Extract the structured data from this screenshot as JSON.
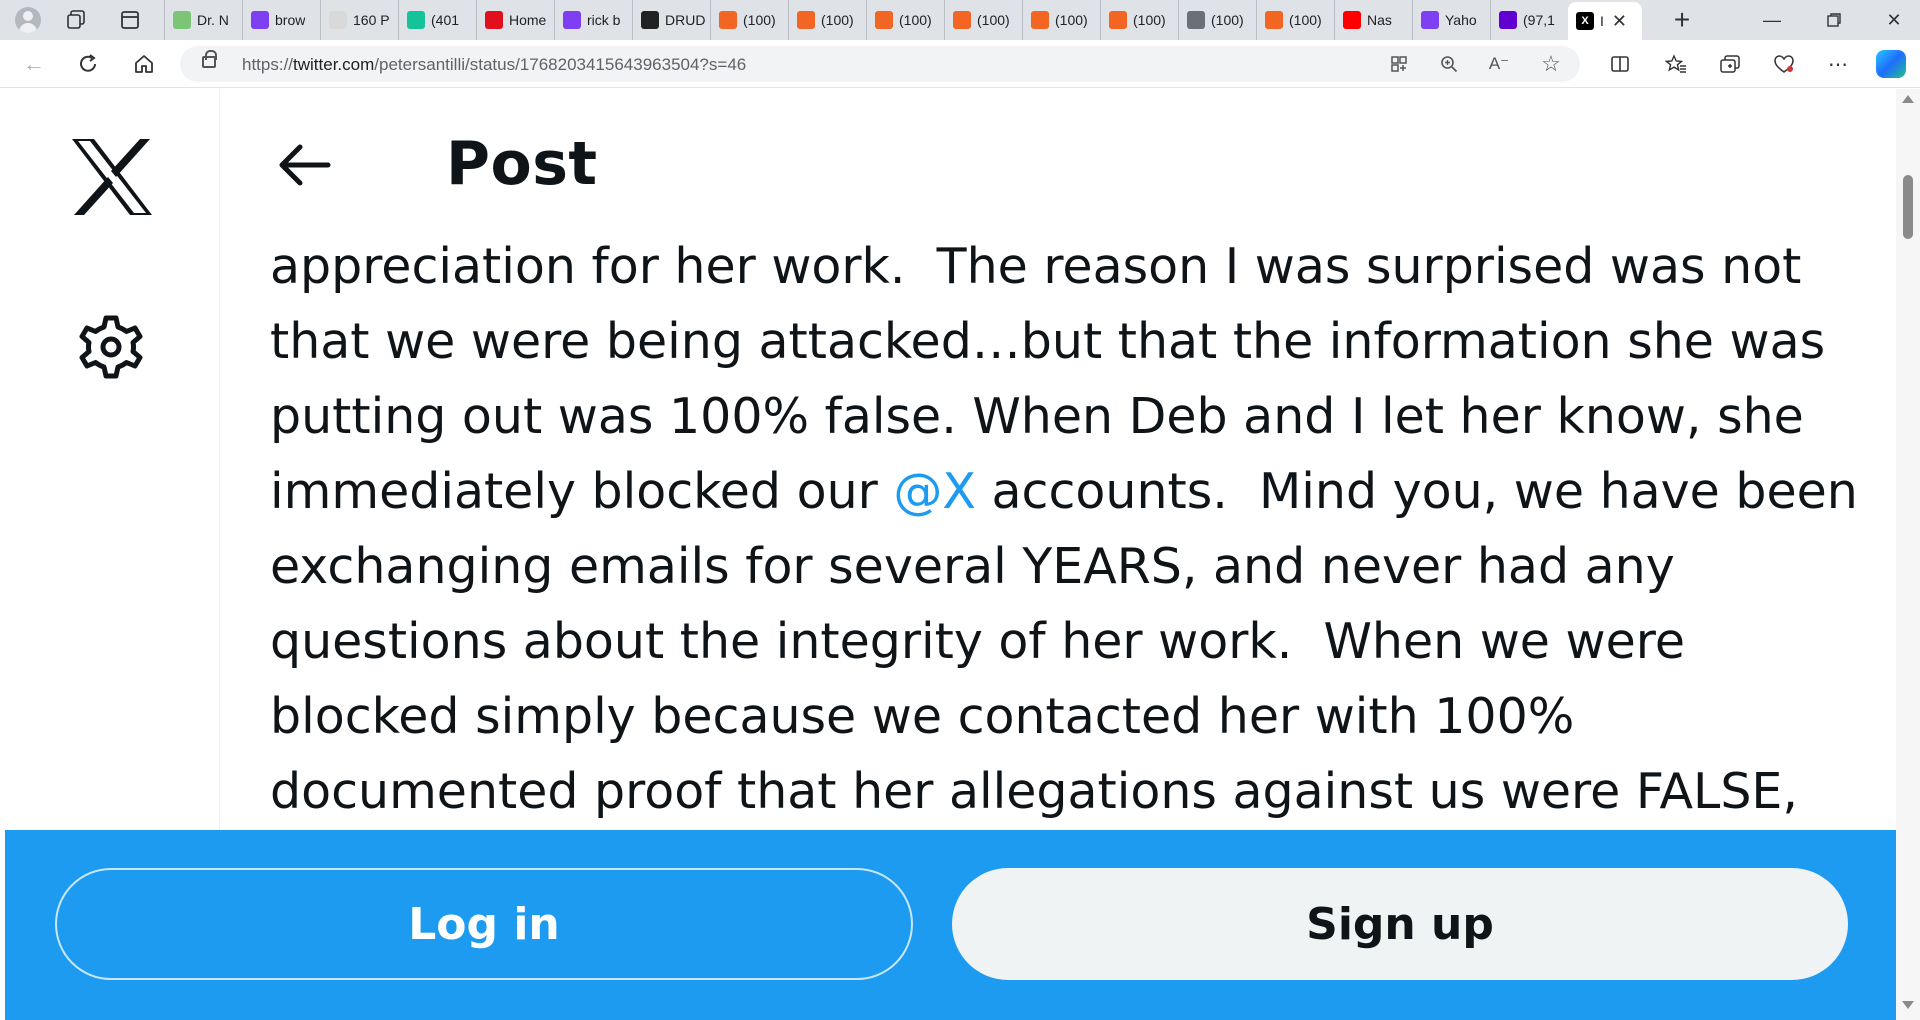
{
  "browser": {
    "tabs": [
      {
        "title": "Dr. N",
        "icon": "play-icon",
        "color": "#7cc576"
      },
      {
        "title": "brow",
        "icon": "yahoo-icon",
        "color": "#7e3ff2"
      },
      {
        "title": "160 P",
        "icon": "bi-icon",
        "color": "#d9d9d9"
      },
      {
        "title": "(401",
        "icon": "grammarly-icon",
        "color": "#15c39a"
      },
      {
        "title": "Home",
        "icon": "home-red-icon",
        "color": "#e0101c"
      },
      {
        "title": "rick b",
        "icon": "yahoo-icon",
        "color": "#7e3ff2"
      },
      {
        "title": "DRUD",
        "icon": "drudge-icon",
        "color": "#222222"
      },
      {
        "title": "(100)",
        "icon": "bookmark-orange-icon",
        "color": "#f26522"
      },
      {
        "title": "(100)",
        "icon": "bookmark-orange-icon",
        "color": "#f26522"
      },
      {
        "title": "(100)",
        "icon": "bookmark-orange-icon",
        "color": "#f26522"
      },
      {
        "title": "(100)",
        "icon": "bookmark-orange-icon",
        "color": "#f26522"
      },
      {
        "title": "(100)",
        "icon": "bookmark-orange-icon",
        "color": "#f26522"
      },
      {
        "title": "(100)",
        "icon": "bookmark-orange-icon",
        "color": "#f26522"
      },
      {
        "title": "(100)",
        "icon": "gray-app-icon",
        "color": "#6b6f76"
      },
      {
        "title": "(100)",
        "icon": "bookmark-orange-icon",
        "color": "#f26522"
      },
      {
        "title": "Nas",
        "icon": "youtube-icon",
        "color": "#ff0000"
      },
      {
        "title": "Yaho",
        "icon": "yahoo-icon",
        "color": "#7e3ff2"
      },
      {
        "title": "(97,1",
        "icon": "mail-icon",
        "color": "#6001d2"
      }
    ],
    "active_tab_title": "I",
    "url_prefix": "https://",
    "url_host": "twitter.com",
    "url_path": "/petersantilli/status/1768203415643963504?s=46"
  },
  "header": {
    "title": "Post"
  },
  "tweet": {
    "lines": [
      "appreciation for her work.  The reason I was surprised was not",
      "that we were being attacked…but that the information she was",
      "putting out was 100% false. When Deb and I let her know, she",
      "immediately blocked our ",
      "exchanging emails for several YEARS, and never had any",
      "questions about the integrity of her work.  When we were",
      "blocked simply because we contacted her with 100%",
      "documented proof that her allegations against us were FALSE,"
    ],
    "mention": "@X",
    "line4_after_mention": " accounts.  Mind you, we have been"
  },
  "auth": {
    "login_label": "Log in",
    "signup_label": "Sign up"
  },
  "colors": {
    "accent": "#1d9bf0",
    "text": "#0f1419"
  }
}
